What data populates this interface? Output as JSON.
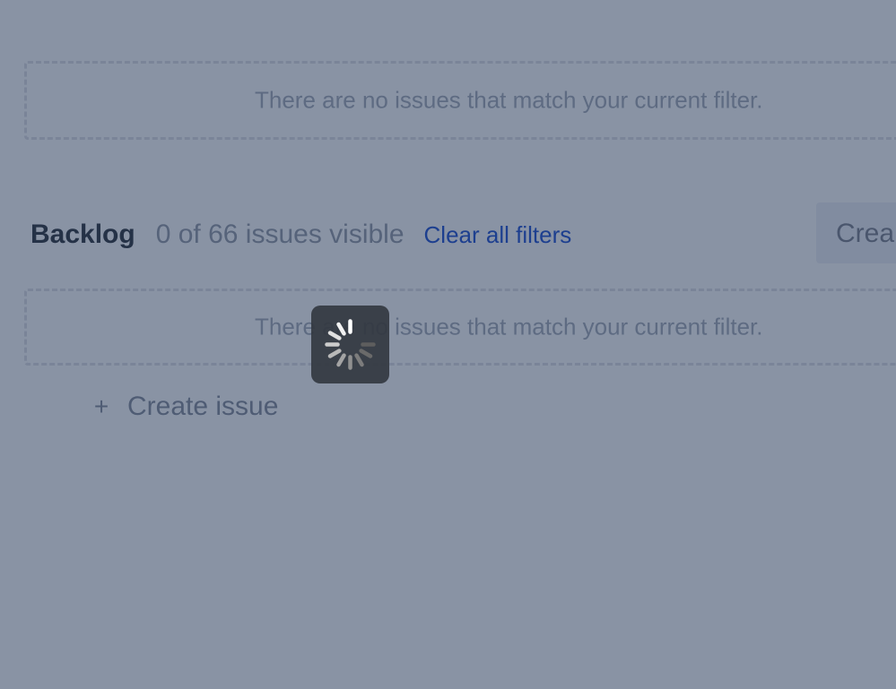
{
  "empty_sections": {
    "top_message": "There are no issues that match your current filter.",
    "backlog_message": "There are no issues that match your current filter."
  },
  "backlog": {
    "title": "Backlog",
    "count_text": "0 of 66 issues visible",
    "clear_filters": "Clear all filters",
    "create_sprint_partial": "Crea"
  },
  "create_issue": {
    "icon": "plus-icon",
    "plus": "+",
    "label": "Create issue"
  },
  "loading": {
    "icon": "spinner-icon"
  },
  "colors": {
    "overlay_background": "#8993a4",
    "link": "#1d3f8f",
    "title": "#253247"
  }
}
